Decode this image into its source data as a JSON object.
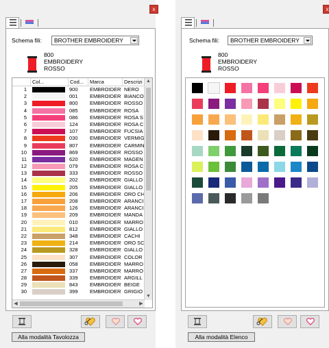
{
  "left_panel": {
    "close_label": "x",
    "scheme_label": "Schema fili:",
    "scheme_value": "BROTHER EMBROIDERY",
    "selected": {
      "code": "800",
      "brand": "EMBROIDERY",
      "name": "ROSSO",
      "color": "#ee1c25"
    },
    "columns": [
      "Col...",
      "Cod...",
      "Marca",
      "Descrizi"
    ],
    "rows": [
      {
        "n": "1",
        "color": "#000000",
        "code": "900",
        "brand": "EMBROIDERY",
        "desc": "NERO"
      },
      {
        "n": "2",
        "color": "#f5f5f5",
        "code": "001",
        "brand": "EMBROIDERY",
        "desc": "BIANCO"
      },
      {
        "n": "3",
        "color": "#ee1c25",
        "code": "800",
        "brand": "EMBROIDERY",
        "desc": "ROSSO"
      },
      {
        "n": "4",
        "color": "#f472a4",
        "code": "085",
        "brand": "EMBROIDERY",
        "desc": "ROSA"
      },
      {
        "n": "5",
        "color": "#f43f7a",
        "code": "086",
        "brand": "EMBROIDERY",
        "desc": "ROSA S"
      },
      {
        "n": "6",
        "color": "#f9cdd8",
        "code": "124",
        "brand": "EMBROIDERY",
        "desc": "ROSA C"
      },
      {
        "n": "7",
        "color": "#cc0e55",
        "code": "107",
        "brand": "EMBROIDERY",
        "desc": "FUCSIA"
      },
      {
        "n": "8",
        "color": "#ee3a1c",
        "code": "030",
        "brand": "EMBROIDERY",
        "desc": "VERMIG"
      },
      {
        "n": "9",
        "color": "#ea3d5b",
        "code": "807",
        "brand": "EMBROIDERY",
        "desc": "CARMIN"
      },
      {
        "n": "10",
        "color": "#8b1a7f",
        "code": "869",
        "brand": "EMBROIDERY",
        "desc": "ROSSO"
      },
      {
        "n": "11",
        "color": "#7a2ea0",
        "code": "620",
        "brand": "EMBROIDERY",
        "desc": "MAGEN"
      },
      {
        "n": "12",
        "color": "#f69ab5",
        "code": "079",
        "brand": "EMBROIDERY",
        "desc": "ROSA C"
      },
      {
        "n": "13",
        "color": "#a93349",
        "code": "333",
        "brand": "EMBROIDERY",
        "desc": "ROSSO"
      },
      {
        "n": "14",
        "color": "#fdfd7e",
        "code": "202",
        "brand": "EMBROIDERY",
        "desc": "GIALLO"
      },
      {
        "n": "15",
        "color": "#fef20a",
        "code": "205",
        "brand": "EMBROIDERY",
        "desc": "GIALLO"
      },
      {
        "n": "16",
        "color": "#f6a80f",
        "code": "206",
        "brand": "EMBROIDERY",
        "desc": "ORO CH"
      },
      {
        "n": "17",
        "color": "#f8a13a",
        "code": "208",
        "brand": "EMBROIDERY",
        "desc": "ARANCI"
      },
      {
        "n": "18",
        "color": "#f8a84f",
        "code": "126",
        "brand": "EMBROIDERY",
        "desc": "ARANCI"
      },
      {
        "n": "19",
        "color": "#fbc07a",
        "code": "209",
        "brand": "EMBROIDERY",
        "desc": "MANDA"
      },
      {
        "n": "20",
        "color": "#fdf3ba",
        "code": "010",
        "brand": "EMBROIDERY",
        "desc": "MARRO"
      },
      {
        "n": "21",
        "color": "#fbea7a",
        "code": "812",
        "brand": "EMBROIDERY",
        "desc": "GIALLO"
      },
      {
        "n": "22",
        "color": "#c9a066",
        "code": "348",
        "brand": "EMBROIDERY",
        "desc": "CACHI"
      },
      {
        "n": "23",
        "color": "#efb114",
        "code": "214",
        "brand": "EMBROIDERY",
        "desc": "ORO SC"
      },
      {
        "n": "24",
        "color": "#b99a20",
        "code": "328",
        "brand": "EMBROIDERY",
        "desc": "GIALLO"
      },
      {
        "n": "25",
        "color": "#fde2c8",
        "code": "307",
        "brand": "EMBROIDERY",
        "desc": "COLOR"
      },
      {
        "n": "26",
        "color": "#2a1a0a",
        "code": "058",
        "brand": "EMBROIDERY",
        "desc": "MARRO"
      },
      {
        "n": "27",
        "color": "#d86a10",
        "code": "337",
        "brand": "EMBROIDERY",
        "desc": "MARRO"
      },
      {
        "n": "28",
        "color": "#c0561c",
        "code": "339",
        "brand": "EMBROIDERY",
        "desc": "ARGILL"
      },
      {
        "n": "29",
        "color": "#ece0b8",
        "code": "843",
        "brand": "EMBROIDERY",
        "desc": "BEIGE"
      },
      {
        "n": "30",
        "color": "#d9cfc7",
        "code": "399",
        "brand": "EMBROIDERY",
        "desc": "GRIGIO"
      }
    ],
    "mode_button_label": "Alla modalità Tavolozza"
  },
  "right_panel": {
    "close_label": "x",
    "scheme_label": "Schema fili:",
    "scheme_value": "BROTHER EMBROIDERY",
    "selected": {
      "code": "800",
      "brand": "EMBROIDERY",
      "name": "ROSSO",
      "color": "#ee1c25"
    },
    "palette": [
      "#000000",
      "#f5f5f5",
      "#ee1c25",
      "#f472a4",
      "#f43f7a",
      "#f9cdd8",
      "#cc0e55",
      "#ee3a1c",
      "#ea3d5b",
      "#8b1a7f",
      "#7a2ea0",
      "#f69ab5",
      "#a93349",
      "#fdfd7e",
      "#fef20a",
      "#f6a80f",
      "#f8a13a",
      "#f8a84f",
      "#fbc07a",
      "#fdf3ba",
      "#fbea7a",
      "#c9a066",
      "#efb114",
      "#b99a20",
      "#fde2c8",
      "#2a1a0a",
      "#d86a10",
      "#c0561c",
      "#ece0b8",
      "#d9cfc7",
      "#8b6a1a",
      "#4a3a10",
      "#a7d8c4",
      "#7fcf6c",
      "#3e9a3a",
      "#1a3a2a",
      "#3d5a1e",
      "#0a6a3a",
      "#0a7a5a",
      "#0a3a1e",
      "#dcf05a",
      "#6cc03a",
      "#3a8a3a",
      "#0a5a9a",
      "#0a6aaa",
      "#8ad8e8",
      "#1a88c8",
      "#0a4a8a",
      "#1a4a3a",
      "#1a2a7a",
      "#3a5aaa",
      "#e8a8d8",
      "#a070c8",
      "#4a1a8a",
      "#3a2a8a",
      "#b0b0d8",
      "#5a6aaa",
      "#4a5a5a",
      "#2a2a2a",
      "#9a9a9a",
      "#7a7a7a"
    ],
    "mode_button_label": "Alla modalità Elenco"
  }
}
